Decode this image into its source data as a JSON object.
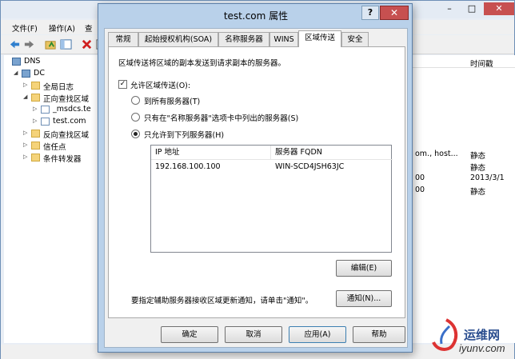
{
  "bg": {
    "menu": [
      "文件(F)",
      "操作(A)",
      "查"
    ],
    "tree": [
      {
        "label": "DNS",
        "indent": 0
      },
      {
        "label": "DC",
        "indent": 1
      },
      {
        "label": "全局日志",
        "indent": 2
      },
      {
        "label": "正向查找区域",
        "indent": 2
      },
      {
        "label": "_msdcs.te",
        "indent": 3
      },
      {
        "label": "test.com",
        "indent": 3
      },
      {
        "label": "反向查找区域",
        "indent": 2
      },
      {
        "label": "信任点",
        "indent": 2
      },
      {
        "label": "条件转发器",
        "indent": 2
      }
    ],
    "list_header": "时间戳",
    "list_cells": [
      {
        "text": "om., host...",
        "col": 0,
        "row": 0
      },
      {
        "text": "静态",
        "col": 1,
        "row": 0
      },
      {
        "text": "静态",
        "col": 1,
        "row": 1
      },
      {
        "text": "00",
        "col": 0,
        "row": 2
      },
      {
        "text": "2013/3/1",
        "col": 1,
        "row": 2
      },
      {
        "text": "00",
        "col": 0,
        "row": 3
      },
      {
        "text": "静态",
        "col": 1,
        "row": 3
      }
    ]
  },
  "dialog": {
    "title": "test.com 属性",
    "help_label": "?",
    "close_label": "✕",
    "tabs": [
      "常规",
      "起始授权机构(SOA)",
      "名称服务器",
      "WINS",
      "区域传送",
      "安全"
    ],
    "active_tab": "区域传送",
    "description": "区域传送将区域的副本发送到请求副本的服务器。",
    "allow_transfer_label": "允许区域传送(O):",
    "allow_transfer_checked": true,
    "radio_options": [
      {
        "label": "到所有服务器(T)",
        "selected": false
      },
      {
        "label": "只有在\"名称服务器\"选项卡中列出的服务器(S)",
        "selected": false
      },
      {
        "label": "只允许到下列服务器(H)",
        "selected": true
      }
    ],
    "server_list": {
      "columns": [
        "IP 地址",
        "服务器 FQDN"
      ],
      "rows": [
        {
          "ip": "192.168.100.100",
          "fqdn": "WIN-SCD4JSH63JC"
        }
      ]
    },
    "edit_button": "编辑(E)",
    "notify_text": "要指定辅助服务器接收区域更新通知，请单击\"通知\"。",
    "notify_button": "通知(N)...",
    "footer_buttons": [
      "确定",
      "取消",
      "应用(A)",
      "帮助"
    ]
  },
  "watermark": {
    "brand": "运维网",
    "url": "iyunv.com"
  },
  "colors": {
    "dialog_frame": "#b9d1ea",
    "close_button": "#c75050",
    "window_bg": "#f0f0f0"
  }
}
